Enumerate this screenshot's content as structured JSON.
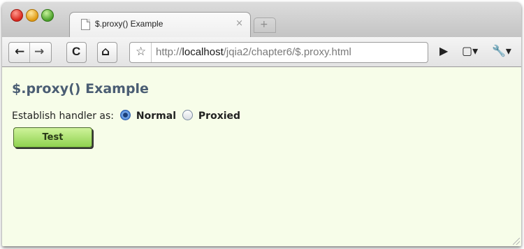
{
  "browser": {
    "tab": {
      "title": "$.proxy() Example",
      "close": "×",
      "new_tab": "+"
    },
    "toolbar": {
      "back": "←",
      "forward": "→",
      "reload": "C",
      "home": "⌂",
      "bookmark": "☆",
      "url": {
        "scheme": "http://",
        "host": "localhost",
        "path": "/jqia2/chapter6/$.proxy.html"
      },
      "play": "▶",
      "page_menu": "▢▾",
      "tools_menu": "🔧▾"
    }
  },
  "page": {
    "title": "$.proxy() Example",
    "handler_label": "Establish handler as:",
    "options": [
      {
        "label": "Normal",
        "checked": true
      },
      {
        "label": "Proxied",
        "checked": false
      }
    ],
    "test_button": "Test"
  },
  "colors": {
    "page_background": "#f7fde9",
    "title_color": "#4a5d73",
    "button_gradient_top": "#cff39b",
    "button_gradient_bottom": "#8fd24f"
  }
}
